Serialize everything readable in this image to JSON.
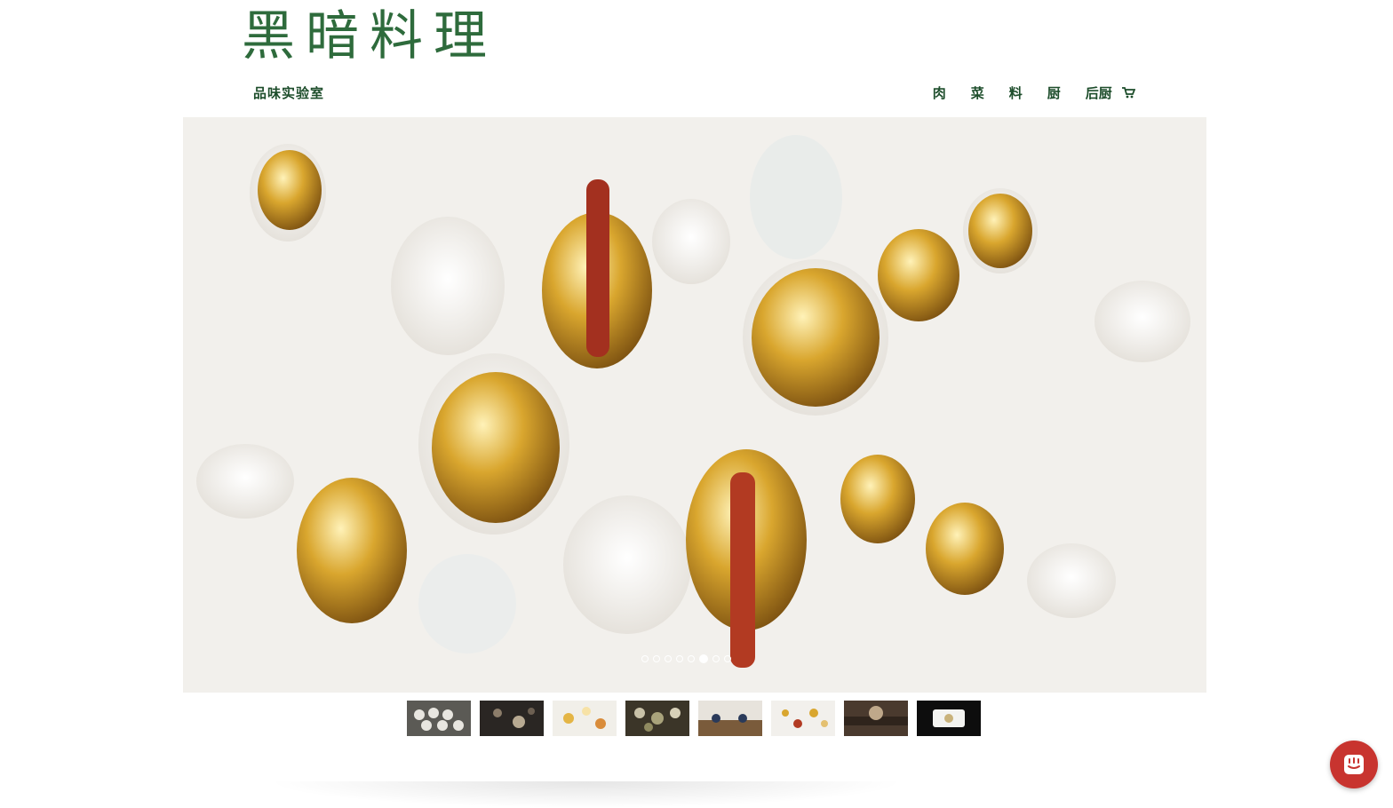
{
  "header": {
    "logo_text": "黑暗料理",
    "subtitle": "品味实验室"
  },
  "nav": {
    "items": [
      {
        "label": "肉"
      },
      {
        "label": "菜"
      },
      {
        "label": "料"
      },
      {
        "label": "厨"
      },
      {
        "label": "后厨"
      }
    ],
    "cart_icon": "shopping-cart-icon"
  },
  "slider": {
    "slide_count": 8,
    "active_index": 6,
    "thumbnails": [
      {
        "alt": "thumbnail-1"
      },
      {
        "alt": "thumbnail-2"
      },
      {
        "alt": "thumbnail-3"
      },
      {
        "alt": "thumbnail-4"
      },
      {
        "alt": "thumbnail-5"
      },
      {
        "alt": "thumbnail-6"
      },
      {
        "alt": "thumbnail-7"
      },
      {
        "alt": "thumbnail-8"
      }
    ]
  },
  "chat": {
    "icon": "chat-bubble-icon",
    "color": "#c8342f"
  },
  "colors": {
    "brand_green": "#2e6b3c",
    "nav_green": "#1d4d2b"
  }
}
